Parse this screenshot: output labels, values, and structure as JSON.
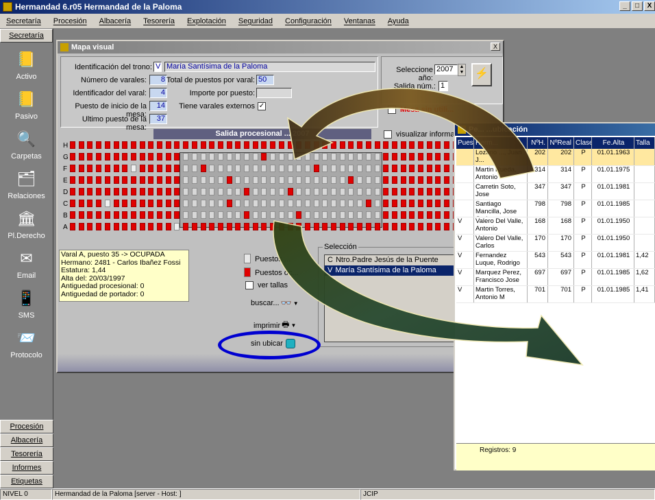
{
  "app": {
    "title": "Hermandad 6.r05  Hermandad de la Paloma",
    "min": "_",
    "max": "□",
    "close": "X"
  },
  "menu": [
    "Secretaría",
    "Procesión",
    "Albacería",
    "Tesorería",
    "Explotación",
    "Seguridad",
    "Configuración",
    "Ventanas",
    "Ayuda"
  ],
  "sidebar": {
    "top": "Secretaría",
    "items": [
      {
        "label": "Activo",
        "icon": "book-icon"
      },
      {
        "label": "Pasivo",
        "icon": "book-icon"
      },
      {
        "label": "Carpetas",
        "icon": "search-icon"
      },
      {
        "label": "Relaciones",
        "icon": "tree-icon"
      },
      {
        "label": "Pl.Derecho",
        "icon": "column-icon"
      },
      {
        "label": "Email",
        "icon": "email-icon"
      },
      {
        "label": "SMS",
        "icon": "phone-icon"
      },
      {
        "label": "Protocolo",
        "icon": "envelope-icon"
      }
    ],
    "bottom": [
      "Procesión",
      "Albacería",
      "Tesorería",
      "Informes",
      "Etiquetas"
    ]
  },
  "status": {
    "level": "NIVEL 0",
    "server": "Hermandad de la Paloma [server - Host: ]",
    "user": "JCIP"
  },
  "mapa": {
    "title": "Mapa visual",
    "close": "X",
    "id_trono_label": "Identificación del trono:",
    "id_trono_code": "V",
    "id_trono_name": "María Santísima de la Paloma",
    "num_varales_label": "Número de varales:",
    "num_varales": "8",
    "total_puestos_label": "Total de puestos por varal:",
    "total_puestos": "50",
    "id_varal_label": "Identificador del varal:",
    "id_varal": "4",
    "importe_label": "Importe por puesto:",
    "importe": "",
    "inicio_mesa_label": "Puesto de inicio de la mesa:",
    "inicio_mesa": "14",
    "varales_ext_label": "Tiene varales externos",
    "varales_ext": "✓",
    "ultimo_mesa_label": "Ultimo puesto de la mesa:",
    "ultimo_mesa": "37",
    "anio_label": "Seleccione año:",
    "anio": "2007",
    "salida_label": "Salida núm.:",
    "salida": "1",
    "mesa_sin_label": "Mesa sin utili...",
    "grid_title": "Salida procesional ... 2007",
    "visualizar_label": "visualizar informaci...",
    "rows": [
      "H",
      "G",
      "F",
      "E",
      "D",
      "C",
      "B",
      "A"
    ],
    "info_lines": [
      "Varal A, puesto 35 -> OCUPADA",
      "Hermano: 2481 - Carlos Ibañez Fossi",
      "Estatura: 1,44",
      "Alta del: 20/03/1997",
      "Antiguedad procesional: 0",
      "Antiguedad de portador: 0"
    ],
    "legend_libres": "Puestos ...",
    "legend_ocupados": "Puestos oc...",
    "ver_tallas": "ver tallas",
    "buscar": "buscar...",
    "imprimir": "imprimir",
    "sin_ubicar": "sin ubicar",
    "seleccion_label": "Selección",
    "seleccion_items": [
      {
        "code": "C",
        "name": "Ntro.Padre Jesús de la Puente"
      },
      {
        "code": "V",
        "name": "María Santísima de la Paloma"
      }
    ]
  },
  "popup": {
    "title": "Pe...  ...ubicación",
    "headers": [
      "Puest",
      "Herm...",
      "Nº",
      "NºH.",
      "NºReal",
      "Clase",
      "Fe.Alta",
      "Talla"
    ],
    "rows": [
      {
        "p": "",
        "name": "Lozano ..., Juan J...",
        "nh": "202",
        "real": "202",
        "clase": "P",
        "alta": "01.01.1963",
        "talla": ""
      },
      {
        "p": "",
        "name": "Martin Rueda, Antonio",
        "nh": "314",
        "real": "314",
        "clase": "P",
        "alta": "01.01.1975",
        "talla": ""
      },
      {
        "p": "",
        "name": "Carretin Soto, Jose",
        "nh": "347",
        "real": "347",
        "clase": "P",
        "alta": "01.01.1981",
        "talla": ""
      },
      {
        "p": "",
        "name": "Santiago Mancilla, Jose Carlos",
        "nh": "798",
        "real": "798",
        "clase": "P",
        "alta": "01.01.1985",
        "talla": ""
      },
      {
        "p": "V",
        "name": "Valero Del Valle, Antonio",
        "nh": "168",
        "real": "168",
        "clase": "P",
        "alta": "01.01.1950",
        "talla": ""
      },
      {
        "p": "V",
        "name": "Valero Del Valle, Carlos",
        "nh": "170",
        "real": "170",
        "clase": "P",
        "alta": "01.01.1950",
        "talla": ""
      },
      {
        "p": "V",
        "name": "Fernandez Luque, Rodrigo",
        "nh": "543",
        "real": "543",
        "clase": "P",
        "alta": "01.01.1981",
        "talla": "1,42"
      },
      {
        "p": "V",
        "name": "Marquez Perez, Francisco Jose",
        "nh": "697",
        "real": "697",
        "clase": "P",
        "alta": "01.01.1985",
        "talla": "1,62"
      },
      {
        "p": "V",
        "name": "Martin Torres, Antonio M",
        "nh": "701",
        "real": "701",
        "clase": "P",
        "alta": "01.01.1985",
        "talla": "1,41"
      }
    ],
    "footer": "Registros: 9"
  }
}
